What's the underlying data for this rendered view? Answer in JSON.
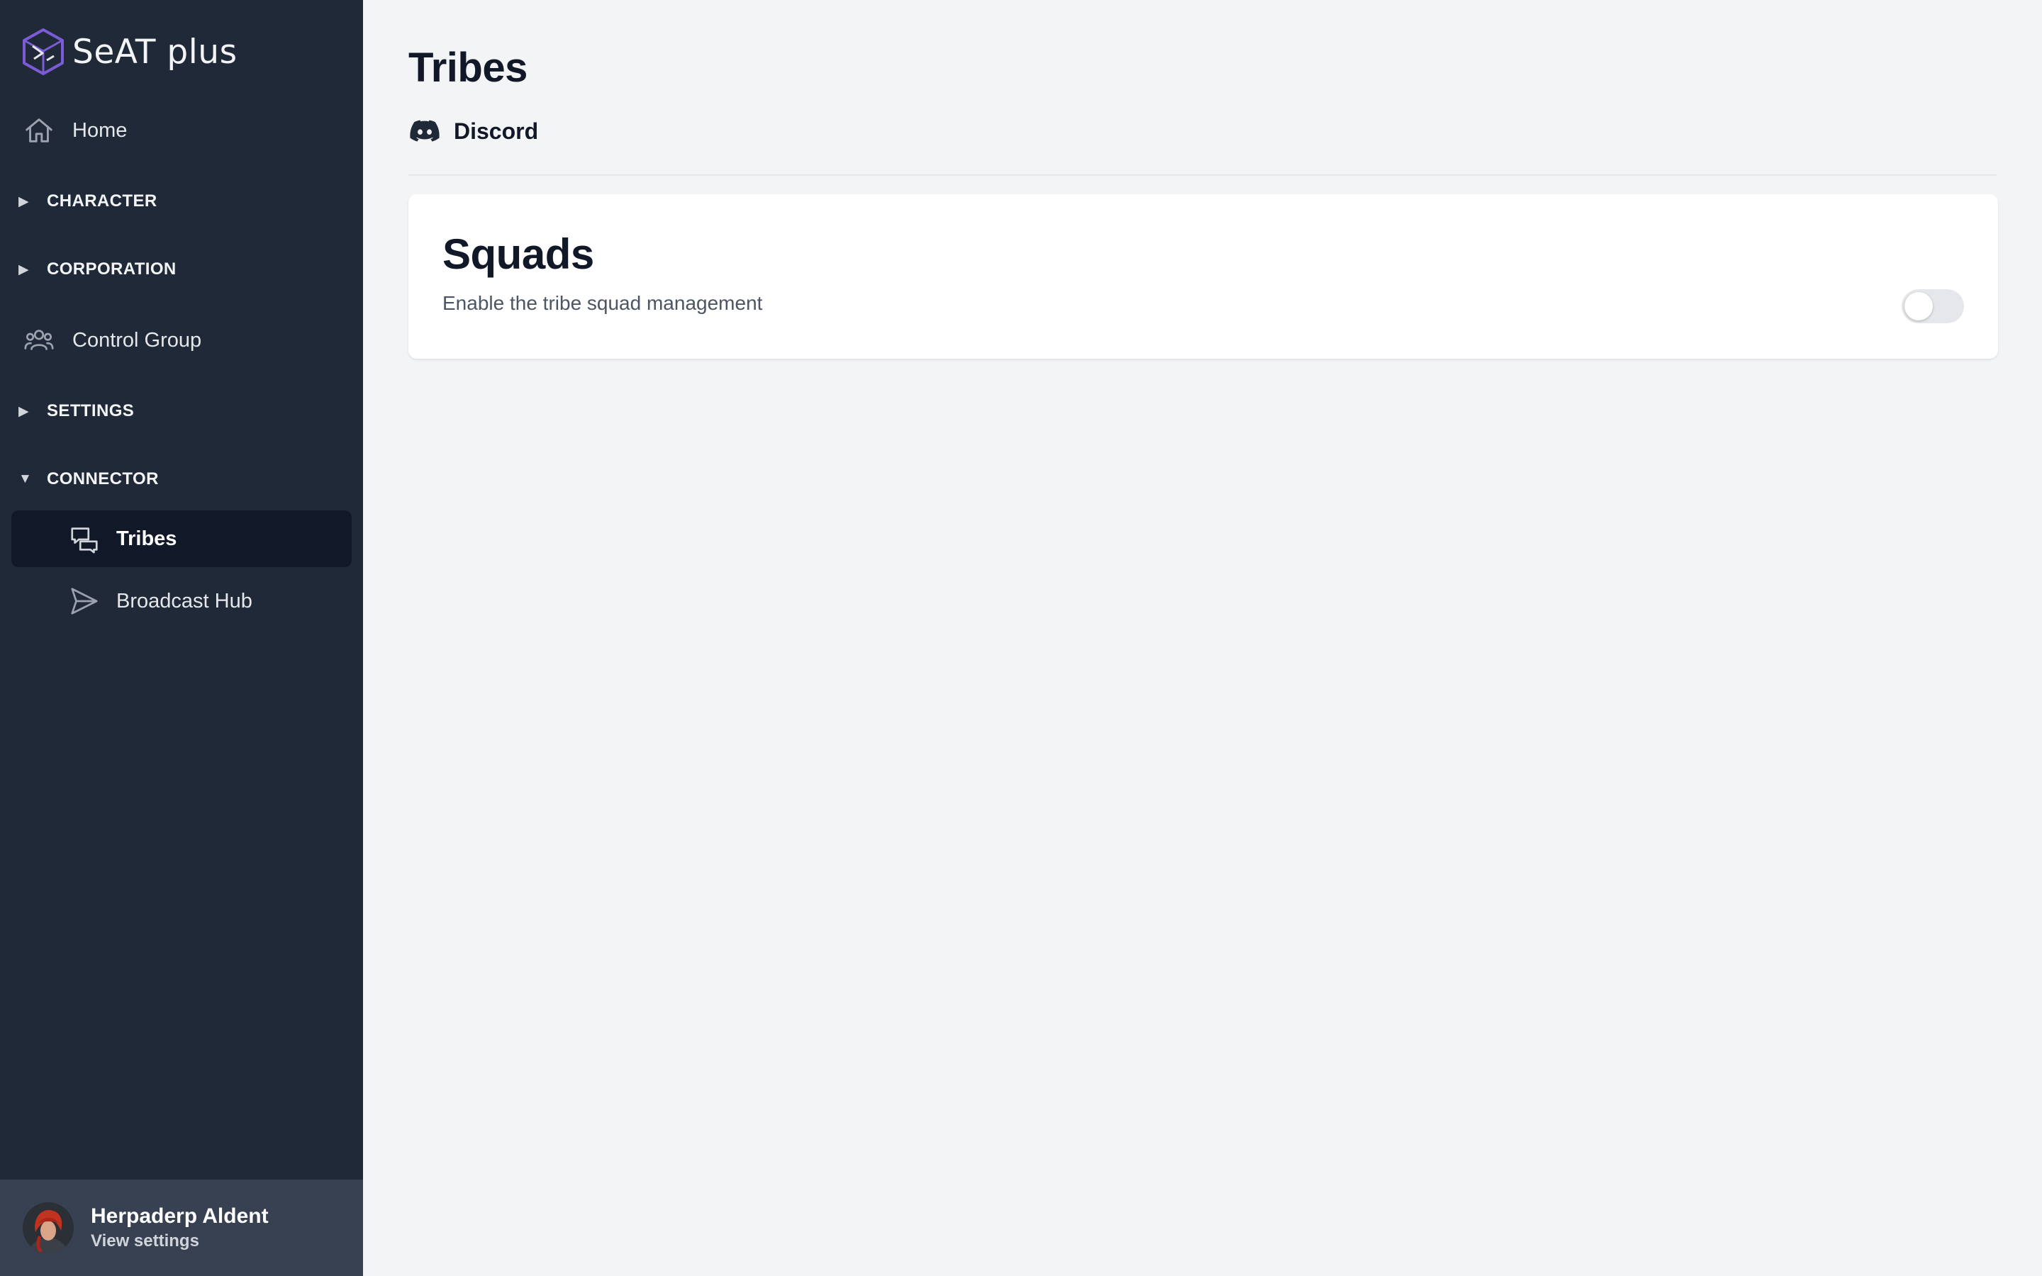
{
  "brand": {
    "name": "SeAT plus",
    "logo_icon": "seat-cube-logo-icon",
    "accent": "#7c5cd6"
  },
  "sidebar": {
    "home": {
      "label": "Home",
      "icon": "home-icon"
    },
    "sections": {
      "character": {
        "label": "CHARACTER",
        "expanded": false
      },
      "corporation": {
        "label": "CORPORATION",
        "expanded": false
      },
      "settings": {
        "label": "SETTINGS",
        "expanded": false
      },
      "connector": {
        "label": "CONNECTOR",
        "expanded": true
      }
    },
    "control_group": {
      "label": "Control Group",
      "icon": "user-group-icon"
    },
    "connector_items": [
      {
        "label": "Tribes",
        "icon": "chat-bubbles-icon",
        "active": true
      },
      {
        "label": "Broadcast Hub",
        "icon": "paper-plane-icon",
        "active": false
      }
    ],
    "caret_collapsed": "▶",
    "caret_expanded": "▼"
  },
  "user": {
    "name": "Herpaderp Aldent",
    "subtitle": "View settings",
    "avatar_icon": "avatar"
  },
  "main": {
    "title": "Tribes",
    "subtitle": {
      "label": "Discord",
      "icon": "discord-icon"
    },
    "card": {
      "title": "Squads",
      "description": "Enable the tribe squad management",
      "toggle_enabled": false
    }
  },
  "colors": {
    "sidebar_bg": "#1f2937",
    "sidebar_active_bg": "#111827",
    "footer_bg": "#374151",
    "main_bg": "#f3f4f6",
    "toggle_off": "#e5e7eb"
  }
}
